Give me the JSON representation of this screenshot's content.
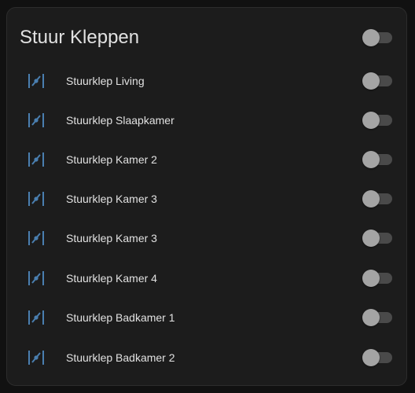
{
  "card": {
    "title": "Stuur Kleppen",
    "master_toggle": {
      "on": false
    }
  },
  "entities": [
    {
      "label": "Stuurklep Living",
      "icon": "valve-icon",
      "on": false
    },
    {
      "label": "Stuurklep Slaapkamer",
      "icon": "valve-icon",
      "on": false
    },
    {
      "label": "Stuurklep Kamer 2",
      "icon": "valve-icon",
      "on": false
    },
    {
      "label": "Stuurklep Kamer 3",
      "icon": "valve-icon",
      "on": false
    },
    {
      "label": "Stuurklep Kamer 3",
      "icon": "valve-icon",
      "on": false
    },
    {
      "label": "Stuurklep Kamer 4",
      "icon": "valve-icon",
      "on": false
    },
    {
      "label": "Stuurklep Badkamer 1",
      "icon": "valve-icon",
      "on": false
    },
    {
      "label": "Stuurklep Badkamer 2",
      "icon": "valve-icon",
      "on": false
    }
  ],
  "colors": {
    "background": "#111111",
    "card": "#1c1c1c",
    "text": "#e1e1e1",
    "icon": "#4a7fb0",
    "toggle_track": "#4a4a4a",
    "toggle_thumb": "#a4a4a4"
  }
}
